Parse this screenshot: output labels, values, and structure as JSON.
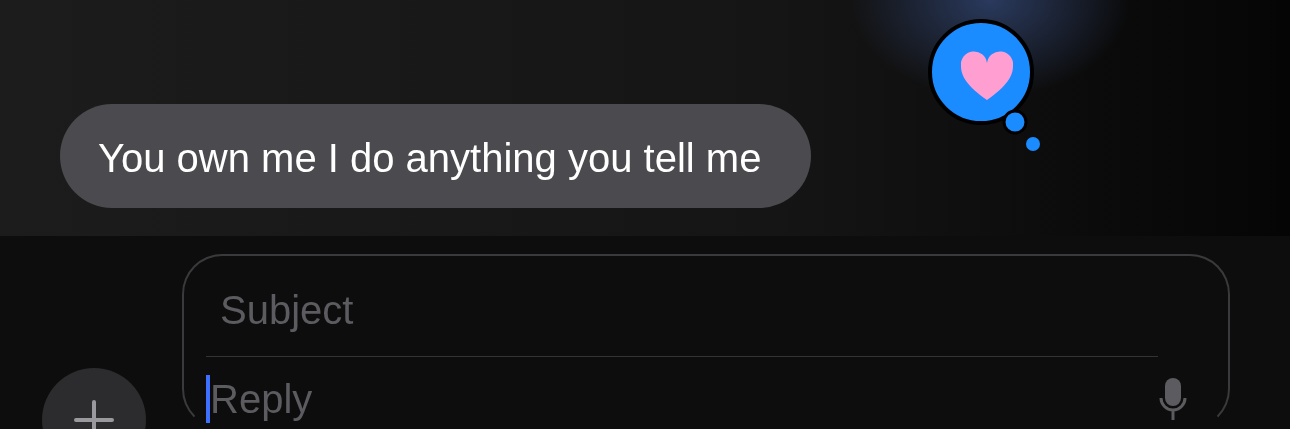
{
  "messages": [
    {
      "text": "You own me I do anything you tell me",
      "from_me": false,
      "reaction": {
        "kind": "heart"
      }
    }
  ],
  "compose": {
    "subject": {
      "placeholder": "Subject"
    },
    "reply": {
      "placeholder": "Reply",
      "focused": true
    }
  }
}
